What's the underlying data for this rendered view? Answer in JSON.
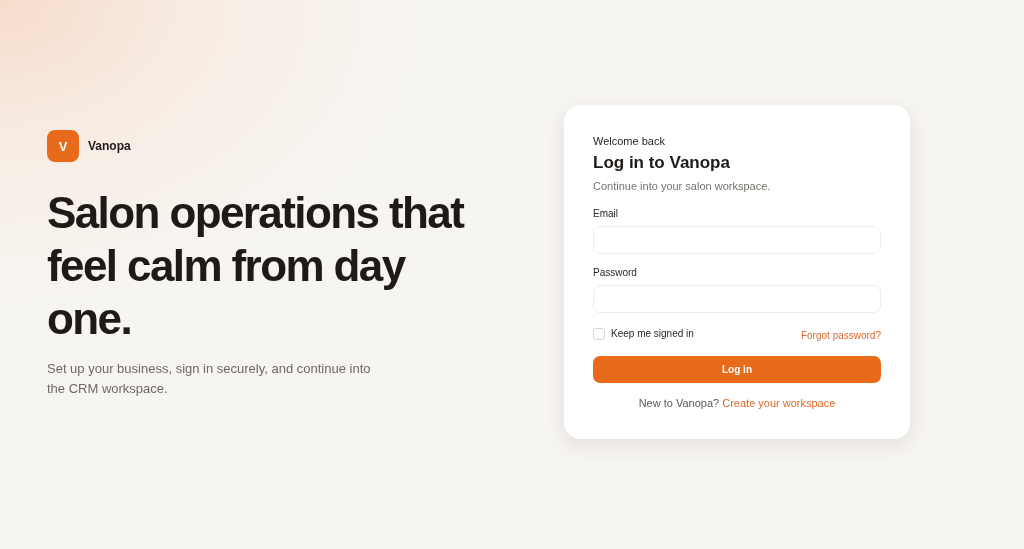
{
  "brand": {
    "initial": "V",
    "name": "Vanopa"
  },
  "headline": "Salon operations that feel calm from day one.",
  "subtitle": "Set up your business, sign in securely, and continue into the CRM workspace.",
  "login": {
    "eyebrow": "Welcome back",
    "title": "Log in to Vanopa",
    "description": "Continue into your salon workspace.",
    "fields": [
      {
        "label": "Email"
      },
      {
        "label": "Password"
      }
    ],
    "remember": {
      "label": "Keep me signed in",
      "checked": false
    },
    "forgot": "Forgot password?",
    "submit": "Log in",
    "signup_prompt": "New to Vanopa?",
    "signup_link": "Create your workspace"
  }
}
